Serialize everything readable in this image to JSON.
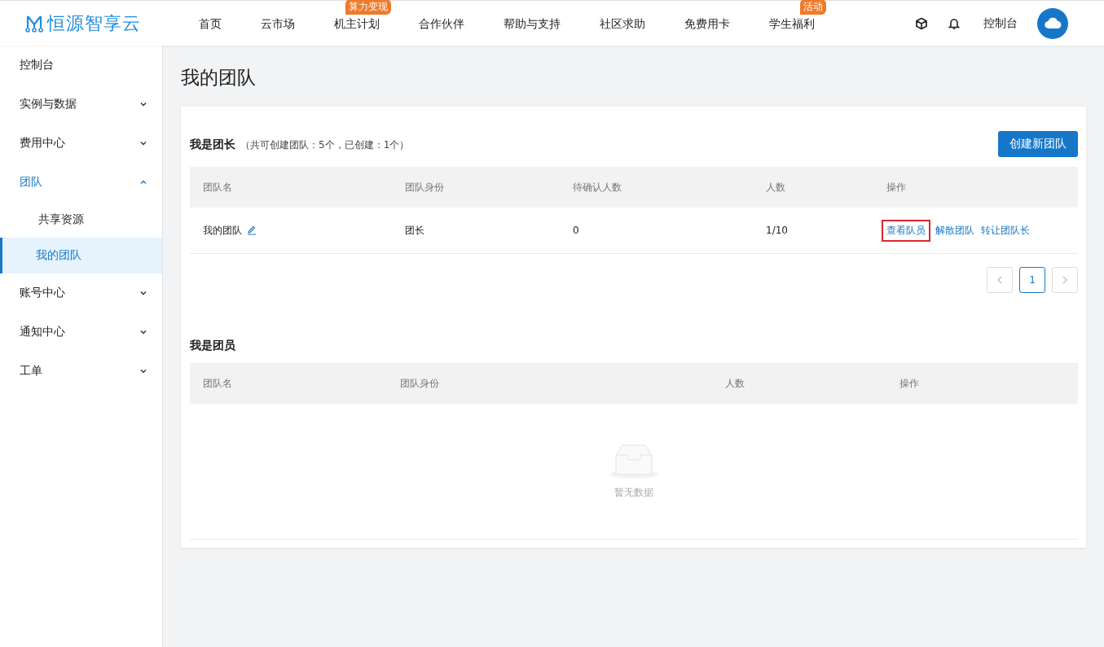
{
  "header": {
    "logo": "恒源智享云",
    "nav": [
      {
        "label": "首页"
      },
      {
        "label": "云市场"
      },
      {
        "label": "机主计划",
        "badge": "算力变现"
      },
      {
        "label": "合作伙伴"
      },
      {
        "label": "帮助与支持"
      },
      {
        "label": "社区求助"
      },
      {
        "label": "免费用卡"
      },
      {
        "label": "学生福利",
        "badge": "活动"
      }
    ],
    "console": "控制台"
  },
  "sidebar": {
    "items": [
      {
        "label": "控制台",
        "selected": false
      },
      {
        "label": "实例与数据",
        "expanded": false,
        "selected": false
      },
      {
        "label": "费用中心",
        "expanded": false,
        "selected": false
      },
      {
        "label": "团队",
        "expanded": true,
        "selected": true,
        "children": [
          {
            "label": "共享资源",
            "selected": false
          },
          {
            "label": "我的团队",
            "selected": true
          }
        ]
      },
      {
        "label": "账号中心",
        "expanded": false,
        "selected": false
      },
      {
        "label": "通知中心",
        "expanded": false,
        "selected": false
      },
      {
        "label": "工单",
        "expanded": false,
        "selected": false
      }
    ]
  },
  "page_title": "我的团队",
  "leader_section": {
    "title": "我是团长",
    "note": "（共可创建团队：5个，已创建：1个）",
    "create_button": "创建新团队",
    "table": {
      "columns": [
        "团队名",
        "团队身份",
        "待确认人数",
        "人数",
        "操作"
      ],
      "rows": [
        {
          "name": "我的团队",
          "role": "团长",
          "pending": "0",
          "count": "1/10",
          "actions": [
            {
              "label": "查看队员",
              "highlighted": true
            },
            {
              "label": "解散团队",
              "highlighted": false
            },
            {
              "label": "转让团队长",
              "highlighted": false
            }
          ]
        }
      ]
    },
    "pagination": {
      "pages": [
        {
          "label": "1",
          "selected": true
        }
      ]
    }
  },
  "member_section": {
    "title": "我是团员",
    "table": {
      "columns": [
        "团队名",
        "团队身份",
        "人数",
        "操作"
      ],
      "empty_text": "暂无数据"
    }
  }
}
